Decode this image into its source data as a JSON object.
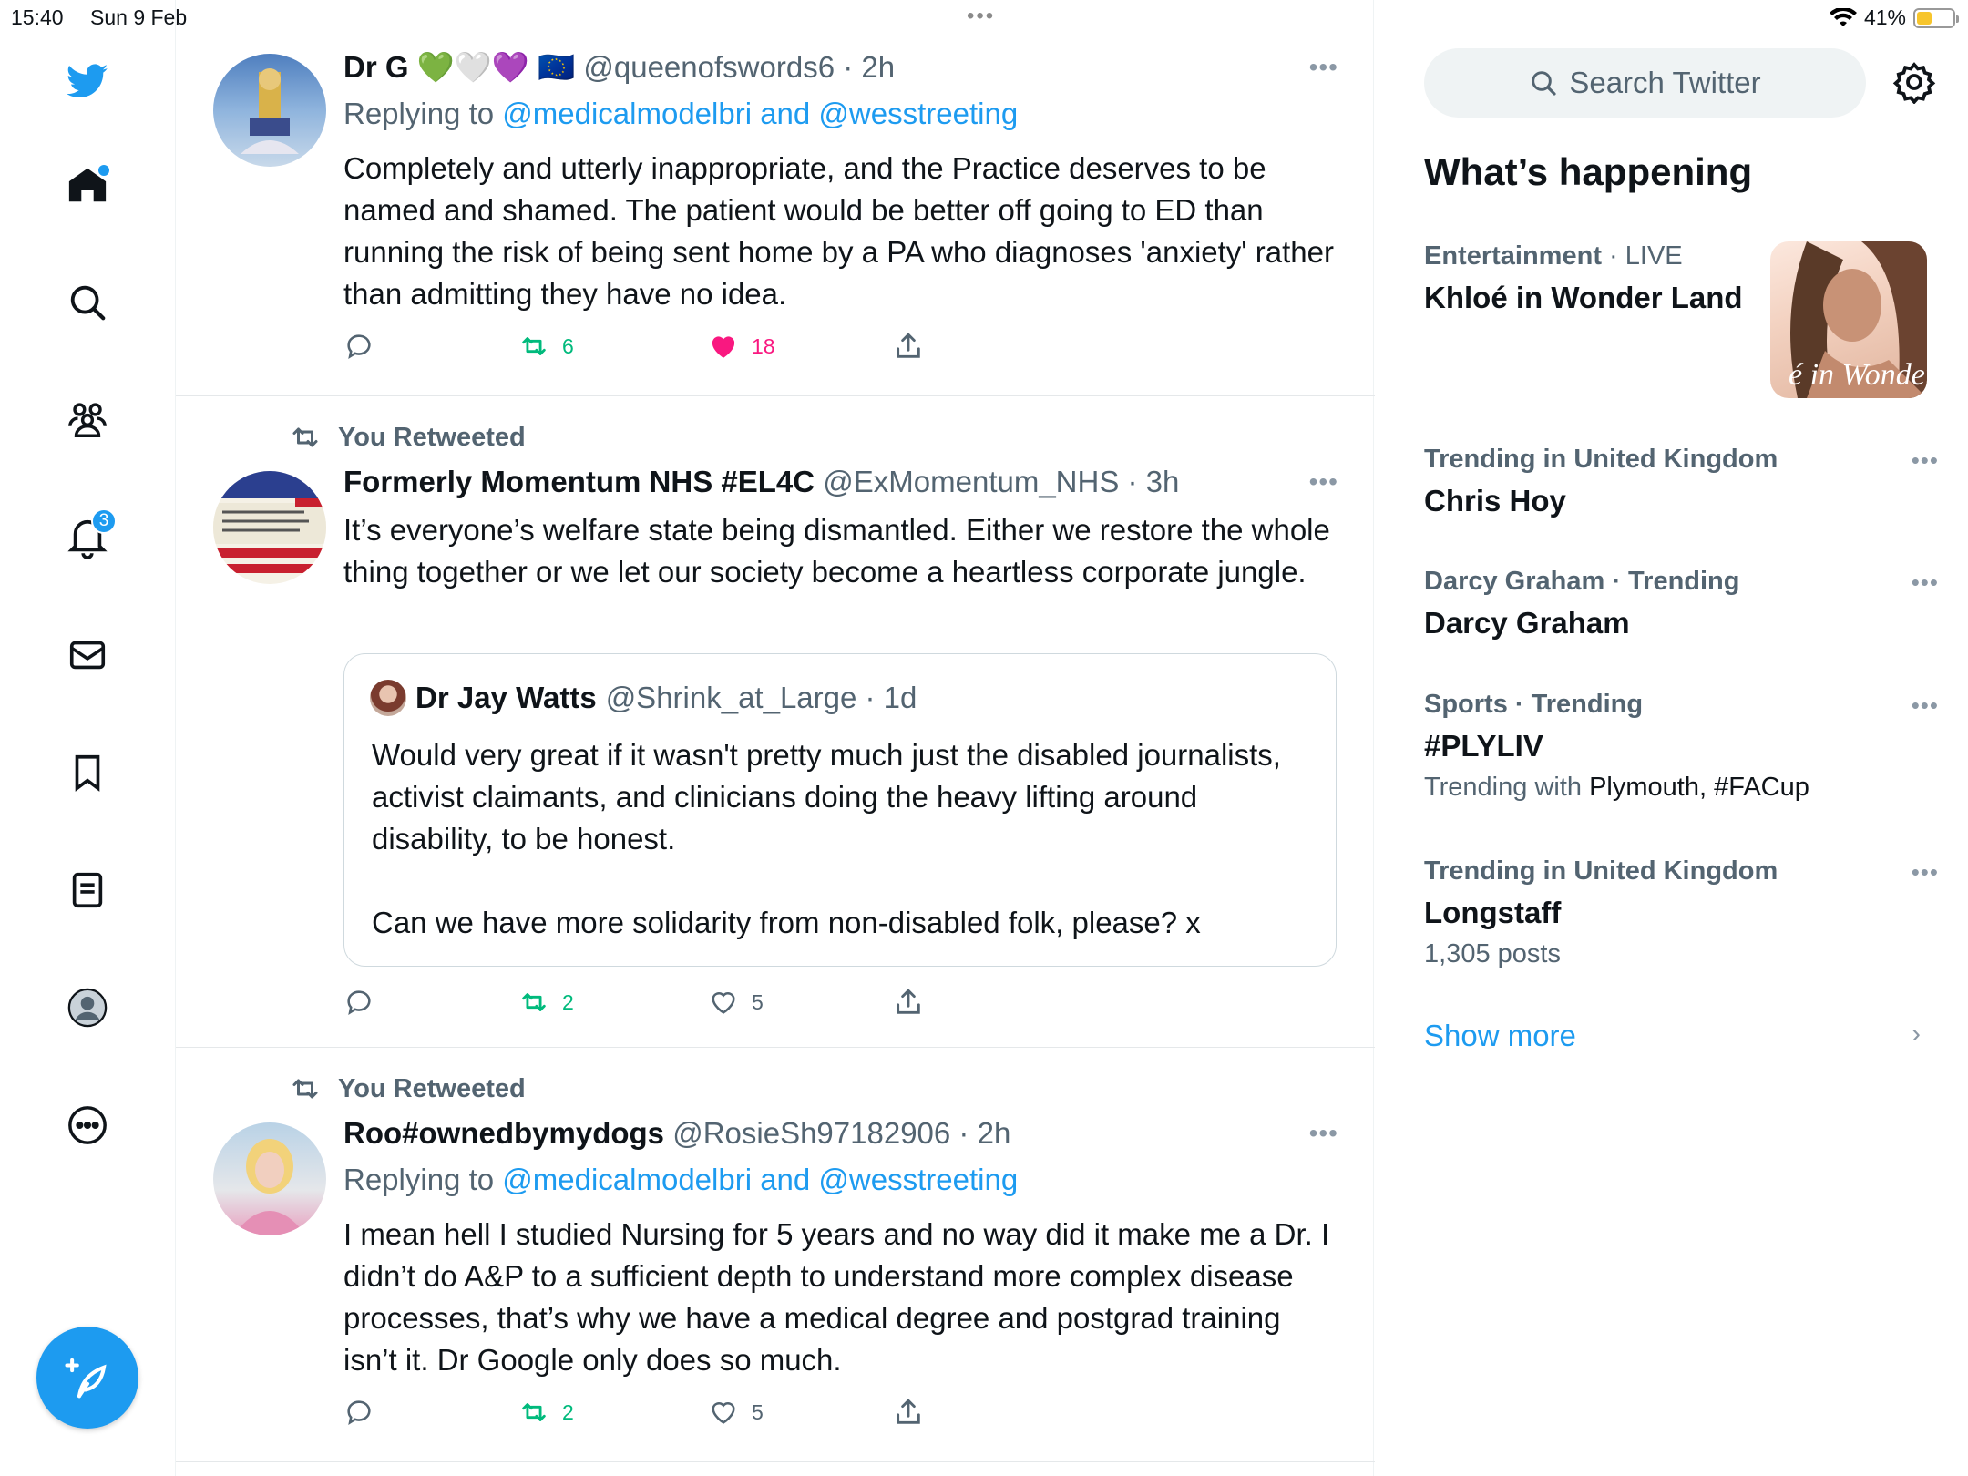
{
  "status_bar": {
    "time": "15:40",
    "date": "Sun 9 Feb",
    "battery": "41%",
    "battery_level": 0.41,
    "dots": "•••"
  },
  "nav": {
    "notifications_count": "3",
    "icons": [
      "twitter-logo-icon",
      "home-icon",
      "search-icon",
      "communities-icon",
      "notifications-icon",
      "messages-icon",
      "bookmarks-icon",
      "lists-icon",
      "profile-icon",
      "more-icon",
      "compose-icon"
    ]
  },
  "tweets": [
    {
      "name": "Dr G 💚🤍💜 🇪🇺",
      "handle": "@queenofswords6 · 2h",
      "replying_prefix": "Replying to ",
      "replying_to": "@medicalmodelbri and @wesstreeting",
      "text": "Completely and utterly inappropriate, and the Practice deserves to be named and shamed. The patient would be better off going to ED than running the risk of being sent home by a PA who diagnoses 'anxiety' rather than admitting they have no idea.",
      "retweets": "6",
      "likes": "18",
      "liked": true
    },
    {
      "retweeted_label": "You Retweeted",
      "name": "Formerly Momentum NHS #EL4C",
      "handle": "@ExMomentum_NHS · 3h",
      "text": "It’s everyone’s welfare state being dismantled. Either we restore the whole thing together or we let our society become a heartless corporate jungle.",
      "quote": {
        "name": "Dr Jay Watts",
        "handle": "@Shrink_at_Large · 1d",
        "text1": "Would very great if it wasn't pretty much just the disabled journalists, activist claimants, and clinicians doing the heavy lifting around disability, to be honest.",
        "text2": "Can we have more solidarity from non-disabled folk, please? x"
      },
      "retweets": "2",
      "likes": "5",
      "liked": false
    },
    {
      "retweeted_label": "You Retweeted",
      "name": "Roo#ownedbymydogs",
      "handle": "@RosieSh97182906 · 2h",
      "replying_prefix": "Replying to ",
      "replying_to": "@medicalmodelbri and @wesstreeting",
      "text": "I mean hell I studied Nursing for 5 years and no way did it make me a Dr. I didn’t do A&P to a sufficient depth to understand more complex disease processes, that’s why we have a medical degree and postgrad training isn’t it. Dr Google only does so much.",
      "retweets": "2",
      "likes": "5",
      "liked": false
    }
  ],
  "sidebar": {
    "search_placeholder": "Search Twitter",
    "whats_happening": "What’s happening",
    "trends": [
      {
        "category": "Entertainment",
        "context": " · LIVE",
        "title": "Khloé in Wonder Land",
        "image_text": "é in Wonder L"
      },
      {
        "category": "Trending in United Kingdom",
        "title": "Chris Hoy"
      },
      {
        "category": "Darcy Graham · Trending",
        "title": "Darcy Graham"
      },
      {
        "category": "Sports · Trending",
        "title": "#PLYLIV",
        "sub_prefix": "Trending with ",
        "sub_value": "Plymouth, #FACup"
      },
      {
        "category": "Trending in United Kingdom",
        "title": "Longstaff",
        "sub": "1,305 posts"
      }
    ],
    "show_more": "Show more",
    "more_dots": "•••",
    "chevron": "›"
  },
  "colors": {
    "accent": "#1d9bf0",
    "retweet_green": "#00ba7c",
    "like_pink": "#f91880",
    "secondary_text": "#536471"
  }
}
